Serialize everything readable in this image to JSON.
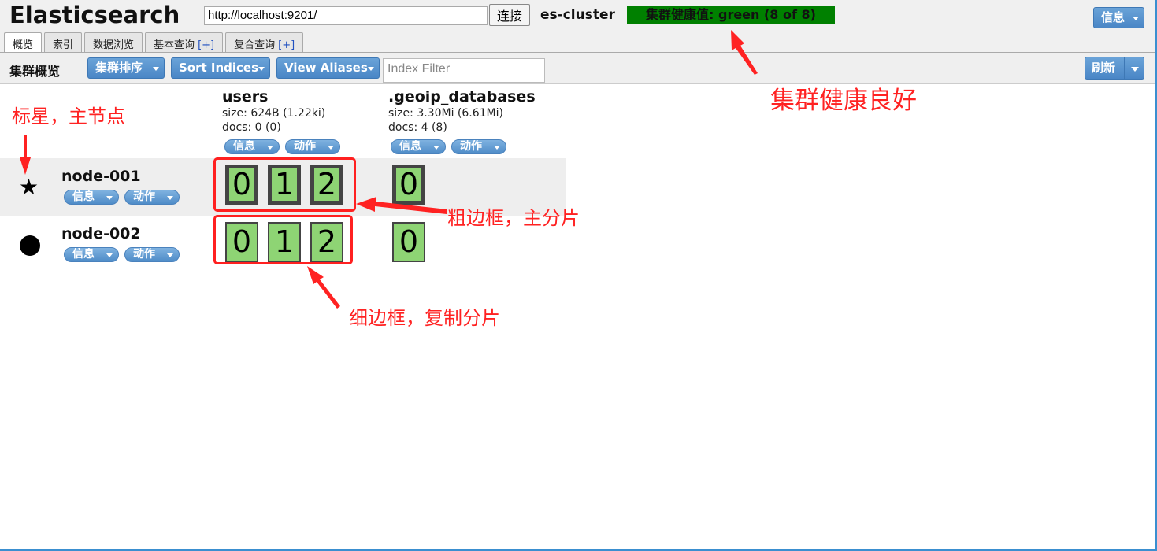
{
  "header": {
    "app_title": "Elasticsearch",
    "url_value": "http://localhost:9201/",
    "connect_label": "连接",
    "cluster_name": "es-cluster",
    "health_text": "集群健康值: green (8 of 8)",
    "health_color": "#008000",
    "info_label": "信息"
  },
  "tabs": [
    {
      "label": "概览",
      "plus": "",
      "active": true
    },
    {
      "label": "索引",
      "plus": "",
      "active": false
    },
    {
      "label": "数据浏览",
      "plus": "",
      "active": false
    },
    {
      "label": "基本查询",
      "plus": "[+]",
      "active": false
    },
    {
      "label": "复合查询",
      "plus": "[+]",
      "active": false
    }
  ],
  "toolbar": {
    "title": "集群概览",
    "sort_cluster_label": "集群排序",
    "sort_indices_label": "Sort Indices",
    "view_aliases_label": "View Aliases",
    "filter_placeholder": "Index Filter",
    "refresh_label": "刷新"
  },
  "indices": [
    {
      "name": "users",
      "size": "size: 624B (1.22ki)",
      "docs": "docs: 0 (0)",
      "info_label": "信息",
      "action_label": "动作"
    },
    {
      "name": ".geoip_databases",
      "size": "size: 3.30Mi (6.61Mi)",
      "docs": "docs: 4 (8)",
      "info_label": "信息",
      "action_label": "动作"
    }
  ],
  "nodes": [
    {
      "name": "node-001",
      "icon": "star-icon",
      "info_label": "信息",
      "action_label": "动作",
      "shards": [
        "0",
        "1",
        "2"
      ],
      "geoip_shards": [
        "0"
      ],
      "shard_type": "primary"
    },
    {
      "name": "node-002",
      "icon": "dot-icon",
      "info_label": "信息",
      "action_label": "动作",
      "shards": [
        "0",
        "1",
        "2"
      ],
      "geoip_shards": [
        "0"
      ],
      "shard_type": "replica"
    }
  ],
  "annotations": {
    "health_note": "集群健康良好",
    "star_note": "标星，主节点",
    "primary_note": "粗边框，主分片",
    "replica_note": "细边框，复制分片"
  },
  "colors": {
    "accent_blue": "#4a86c6",
    "shard_green": "#8ed474",
    "annotation_red": "#ff2222"
  }
}
